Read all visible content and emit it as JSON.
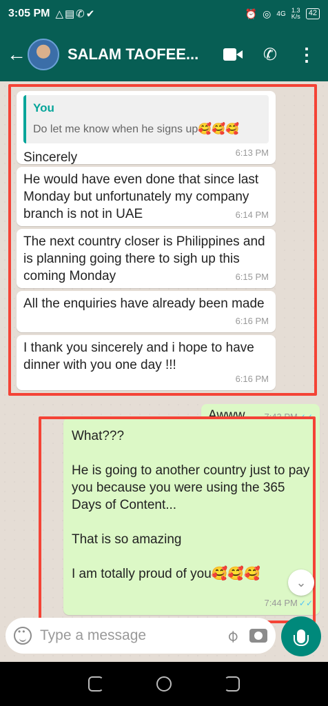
{
  "status_bar": {
    "time": "3:05 PM",
    "left_icons": "△▤✆✔",
    "net_speed_value": "1.3",
    "net_speed_unit": "K/s",
    "signal": "4G",
    "battery": "42"
  },
  "header": {
    "contact_name": "SALAM TAOFEE..."
  },
  "quoted_message": {
    "author": "You",
    "text": "Do let me know when he signs up🥰🥰🥰"
  },
  "incoming_messages": [
    {
      "text": "Sincerely",
      "time": "6:13 PM"
    },
    {
      "text": "He would have even done that since last Monday but unfortunately my company branch is not in UAE",
      "time": "6:14 PM"
    },
    {
      "text": "The next country closer is Philippines and is planning going there to sigh up this coming Monday",
      "time": "6:15 PM"
    },
    {
      "text": "All the enquiries have already been made",
      "time": "6:16 PM"
    },
    {
      "text": "I thank you sincerely and i hope to have dinner with you one day !!!",
      "time": "6:16 PM"
    }
  ],
  "outgoing_messages": [
    {
      "text": "Awww",
      "time": "7:43 PM"
    },
    {
      "text": "What???\n\nHe is going to another country just to pay you because you were using the 365 Days of Content...\n\nThat is so amazing\n\nI am totally proud of you🥰🥰🥰",
      "time": "7:44 PM"
    }
  ],
  "input": {
    "placeholder": "Type a message"
  },
  "colors": {
    "header": "#075e54",
    "outgoing_bubble": "#dcf8c6",
    "highlight": "#f44336",
    "send_button": "#00897b"
  }
}
